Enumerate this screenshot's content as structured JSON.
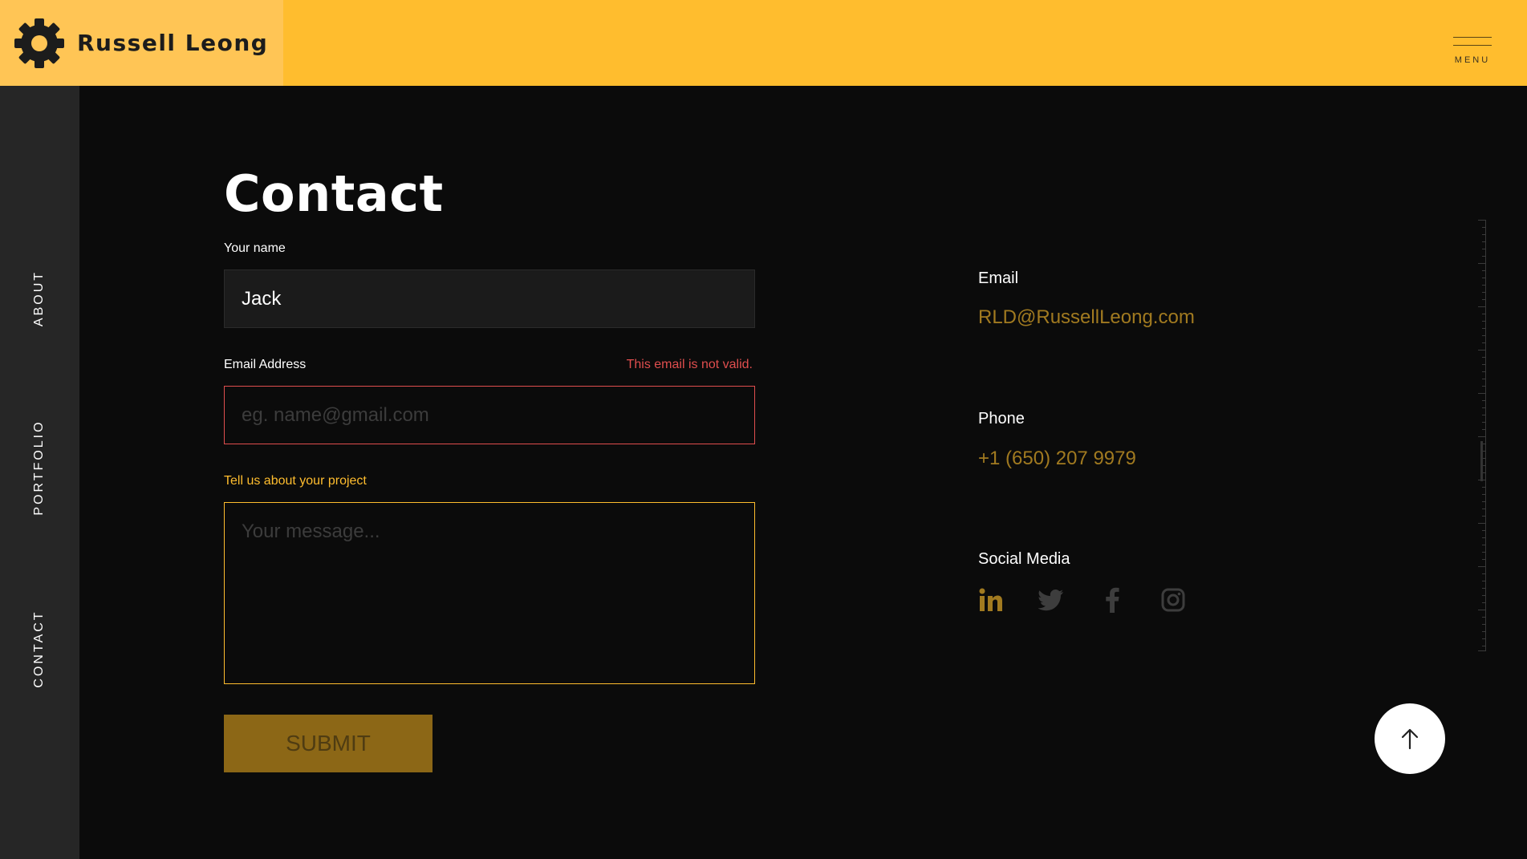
{
  "brand": {
    "name": "Russell Leong",
    "icon": "gear-icon"
  },
  "header": {
    "menu_label": "MENU",
    "menu_icon": "hamburger-menu-icon"
  },
  "sidebar": {
    "items": [
      {
        "label": "ABOUT"
      },
      {
        "label": "PORTFOLIO"
      },
      {
        "label": "CONTACT"
      }
    ]
  },
  "contact": {
    "title": "Contact",
    "name_field": {
      "label": "Your name",
      "value": "Jack"
    },
    "email_field": {
      "label": "Email Address",
      "placeholder": "eg. name@gmail.com",
      "value": "",
      "error": "This email is not valid."
    },
    "message_field": {
      "label": "Tell us about your project",
      "placeholder": "Your message...",
      "value": ""
    },
    "submit_label": "SUBMIT"
  },
  "info": {
    "email_label": "Email",
    "email_value": "RLD@RussellLeong.com",
    "phone_label": "Phone",
    "phone_value": "+1 (650) 207 9979",
    "social_label": "Social Media",
    "social_icons": [
      "linkedin-icon",
      "twitter-icon",
      "facebook-icon",
      "instagram-icon"
    ]
  },
  "scroll_to_top": {
    "icon": "arrow-up-icon"
  },
  "colors": {
    "accent": "#ffbd2e",
    "brand_panel": "#ffc555",
    "background": "#0b0b0b",
    "sidebar": "#262626",
    "error": "#e04e4e",
    "link": "#a17a20",
    "submit": "#8c6716"
  }
}
